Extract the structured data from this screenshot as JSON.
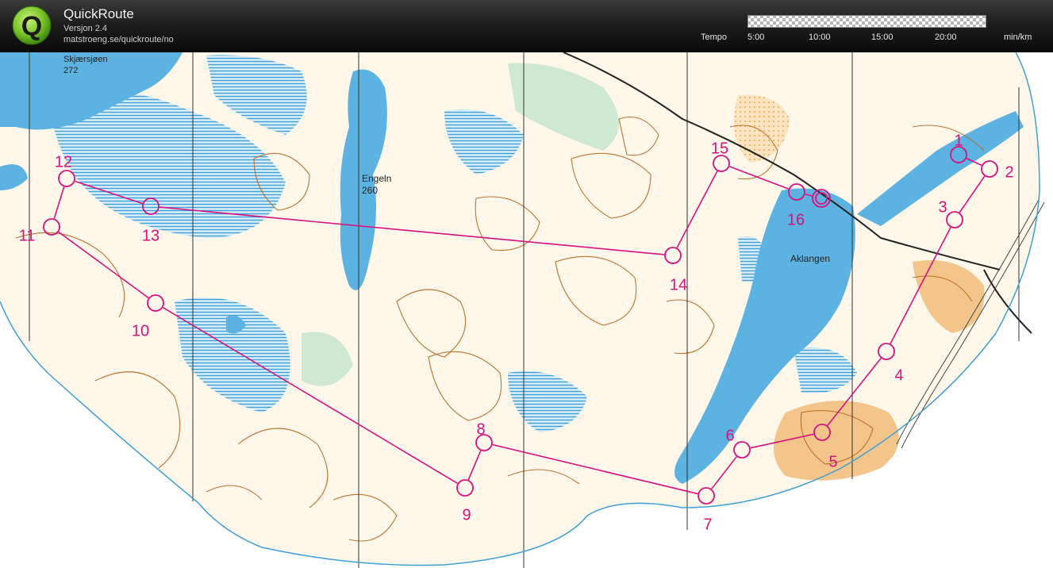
{
  "header": {
    "title": "QuickRoute",
    "version": "Versjon 2.4",
    "url": "matstroeng.se/quickroute/no",
    "logo_letter": "Q"
  },
  "tempo": {
    "label": "Tempo",
    "ticks": [
      "5:00",
      "10:00",
      "15:00",
      "20:00"
    ],
    "unit": "min/km"
  },
  "map": {
    "place_labels": [
      {
        "name": "Skjærsjøen",
        "elevation": "272"
      },
      {
        "name": "Engeln",
        "elevation": "260"
      },
      {
        "name": "Aklangen"
      }
    ],
    "controls": [
      "1",
      "2",
      "3",
      "4",
      "5",
      "6",
      "7",
      "8",
      "9",
      "10",
      "11",
      "12",
      "13",
      "14",
      "15",
      "16"
    ],
    "colors": {
      "course": "#d6127f",
      "water": "#5cb2e0",
      "marsh": "#3f9fd5",
      "contour": "#b5661e",
      "open_land": "#f3c58a",
      "green": "#9fd2a4"
    }
  }
}
